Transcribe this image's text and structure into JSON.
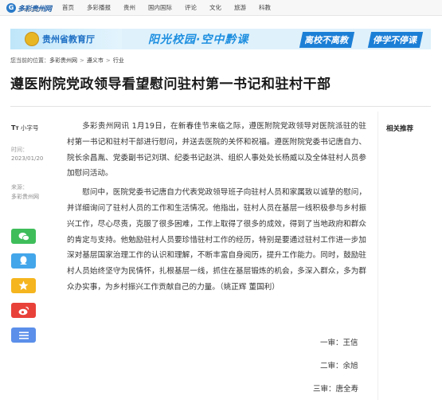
{
  "header": {
    "logo_text": "多彩贵州网",
    "logo_sub": "www.gog.cn",
    "nav": [
      "首页",
      "多彩播报",
      "贵州",
      "国内国际",
      "评论",
      "文化",
      "旅游",
      "科教"
    ]
  },
  "banner": {
    "dept": "贵州省教育厅",
    "slogan": "阳光校园·空中黔课",
    "tag1": "离校不离教",
    "tag2": "停学不停课"
  },
  "breadcrumb": {
    "label": "您当前的位置：",
    "items": [
      "多彩贵州网",
      "遵义市",
      "行业"
    ],
    "separator": ">"
  },
  "article": {
    "title": "遵医附院党政领导看望慰问驻村第一书记和驻村干部",
    "font_toggle": "小字号",
    "time_label": "时间：",
    "time_value": "2023/01/20",
    "source_label": "来源：",
    "source_value": "多彩贵州网",
    "paragraphs": [
      "多彩贵州网讯 1月19日，在新春佳节来临之际，遵医附院党政领导对医院派驻的驻村第一书记和驻村干部进行慰问，并送去医院的关怀和祝福。遵医附院党委书记唐自力、院长余昌胤、党委副书记刘琪、纪委书记赵洪、组织人事处处长杨威以及全体驻村人员参加慰问活动。",
      "慰问中，医院党委书记唐自力代表党政领导班子向驻村人员和家属致以诚挚的慰问，并详细询问了驻村人员的工作和生活情况。他指出，驻村人员在基层一线积极参与乡村振兴工作，尽心尽责，克服了很多困难，工作上取得了很多的成效，得到了当地政府和群众的肯定与支持。他勉励驻村人员要珍惜驻村工作的经历，特别是要通过驻村工作进一步加深对基层国家治理工作的认识和理解，不断丰富自身阅历，提升工作能力。同时，鼓励驻村人员始终坚守为民情怀，扎根基层一线，抓住在基层锻炼的机会，多深入群众，多为群众办实事，为乡村振兴工作贡献自己的力量。（姚正辉 董国利）"
    ],
    "reviews": [
      "一审：王信",
      "二审：余旭",
      "三审：唐全寿"
    ]
  },
  "share": [
    {
      "name": "wechat",
      "color": "#3ebd5a"
    },
    {
      "name": "qq",
      "color": "#43a6ea"
    },
    {
      "name": "qzone",
      "color": "#f5b51e"
    },
    {
      "name": "weibo",
      "color": "#e8413a"
    },
    {
      "name": "more",
      "color": "#5b8fea"
    }
  ],
  "sidebar": {
    "related_title": "相关推荐"
  }
}
